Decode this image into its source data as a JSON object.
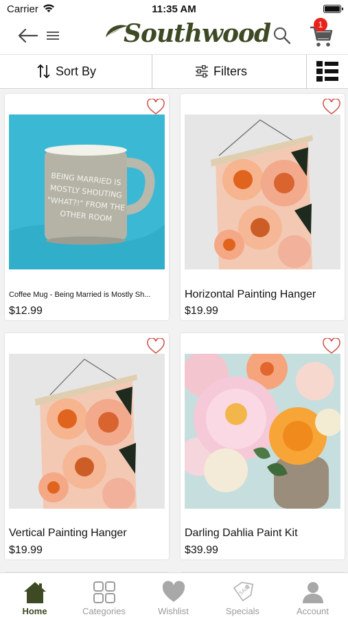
{
  "status_bar": {
    "carrier": "Carrier",
    "time": "11:35 AM"
  },
  "header": {
    "logo_text": "Southwood",
    "cart_count": "1",
    "brand_color": "#3d4a24",
    "badge_color": "#e8231c"
  },
  "toolbar": {
    "sort_label": "Sort By",
    "filters_label": "Filters"
  },
  "products": [
    {
      "name": "Coffee Mug - Being Married is Mostly Sh...",
      "price": "$12.99",
      "image": "coffee-mug",
      "mug_text": [
        "BEING MARRIED IS",
        "MOSTLY SHOUTING",
        "\"WHAT?!\" FROM THE",
        "OTHER ROOM"
      ]
    },
    {
      "name": "Horizontal Painting Hanger",
      "price": "$19.99",
      "image": "painting-hanger"
    },
    {
      "name": "Vertical Painting Hanger",
      "price": "$19.99",
      "image": "painting-hanger"
    },
    {
      "name": "Darling Dahlia Paint Kit",
      "price": "$39.99",
      "image": "dahlia-bouquet"
    }
  ],
  "bottom_nav": {
    "items": [
      {
        "label": "Home",
        "icon": "home-icon",
        "active": true
      },
      {
        "label": "Categories",
        "icon": "categories-icon",
        "active": false
      },
      {
        "label": "Wishlist",
        "icon": "heart-icon",
        "active": false
      },
      {
        "label": "Specials",
        "icon": "sale-tag-icon",
        "active": false
      },
      {
        "label": "Account",
        "icon": "account-icon",
        "active": false
      }
    ]
  }
}
